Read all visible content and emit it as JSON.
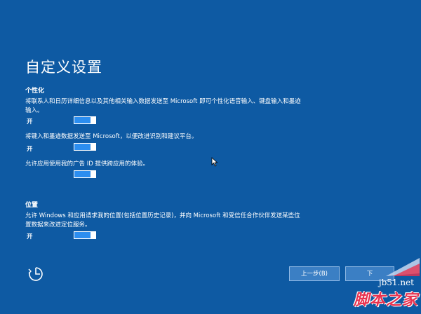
{
  "page": {
    "title": "自定义设置"
  },
  "sections": {
    "personalization": {
      "heading": "个性化",
      "items": [
        {
          "description": "将联系人和日历详细信息以及其他相关输入数据发送至 Microsoft 即可个性化语音输入、键盘输入和墨迹输入。",
          "state": "开"
        },
        {
          "description": "将键入和墨迹数据发送至 Microsoft，以便改进识别和建议平台。",
          "state": "开"
        },
        {
          "description": "允许应用使用我的广告 ID 提供跨应用的体验。",
          "state": "开"
        }
      ]
    },
    "location": {
      "heading": "位置",
      "items": [
        {
          "description": "允许 Windows 和应用请求我的位置(包括位置历史记录)，并向 Microsoft 和受信任合作伙伴发送某些位置数据来改进定位服务。",
          "state": "开"
        }
      ]
    }
  },
  "footer": {
    "ease_of_access_icon": "ease-of-access-icon",
    "back_label": "上一步(B)",
    "next_label": "下"
  },
  "watermark": {
    "url": "jb51.net",
    "logo_text": "脚本之家"
  },
  "colors": {
    "background": "#0e5aa3",
    "toggle_on": "#2c8ef0",
    "watermark_red": "#e8324f"
  }
}
